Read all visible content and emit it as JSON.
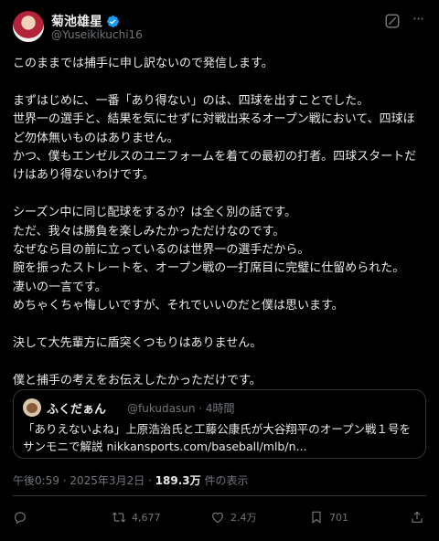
{
  "author": {
    "display_name": "菊池雄星",
    "handle": "@Yuseikikuchi16"
  },
  "tweet": {
    "p1": "このままでは捕手に申し訳ないので発信します。",
    "p2": "まずはじめに、一番「あり得ない」のは、四球を出すことでした。\n世界一の選手と、結果を気にせずに対戦出来るオープン戦において、四球ほど勿体無いものはありません。\nかつ、僕もエンゼルスのユニフォームを着ての最初の打者。四球スタートだけはあり得ないわけです。",
    "p3": "シーズン中に同じ配球をするか？は全く別の話です。\nただ、我々は勝負を楽しみたかっただけなのです。\nなぜなら目の前に立っているのは世界一の選手だから。\n腕を振ったストレートを、オープン戦の一打席目に完璧に仕留められた。\n凄いの一言です。\nめちゃくちゃ悔しいですが、それでいいのだと僕は思います。",
    "p4": "決して大先輩方に盾突くつもりはありません。",
    "p5": "僕と捕手の考えをお伝えしたかっただけです。"
  },
  "quote": {
    "name": "ふくだぁん",
    "meta": "@fukudasun · 4時間",
    "text": "「ありえないよね」上原浩治氏と工藤公康氏が大谷翔平のオープン戦１号をサンモニで解説 nikkansports.com/baseball/mlb/n..."
  },
  "meta": {
    "time": "午後0:59 · 2025年3月2日 · ",
    "views": "189.3万",
    "views_suffix": " 件の表示"
  },
  "actions": {
    "retweets": "4,677",
    "likes": "2.4万",
    "bookmarks": "701"
  },
  "icons": {
    "verified": "verified-badge-icon",
    "grok": "grok-icon",
    "more": "more-icon",
    "reply": "reply-icon",
    "retweet": "retweet-icon",
    "like": "heart-icon",
    "bookmark": "bookmark-icon",
    "share": "share-icon"
  },
  "colors": {
    "background": "#000000",
    "text": "#e7e9ea",
    "secondary": "#71767b",
    "verified": "#1d9bf0",
    "border": "#2f3336"
  }
}
